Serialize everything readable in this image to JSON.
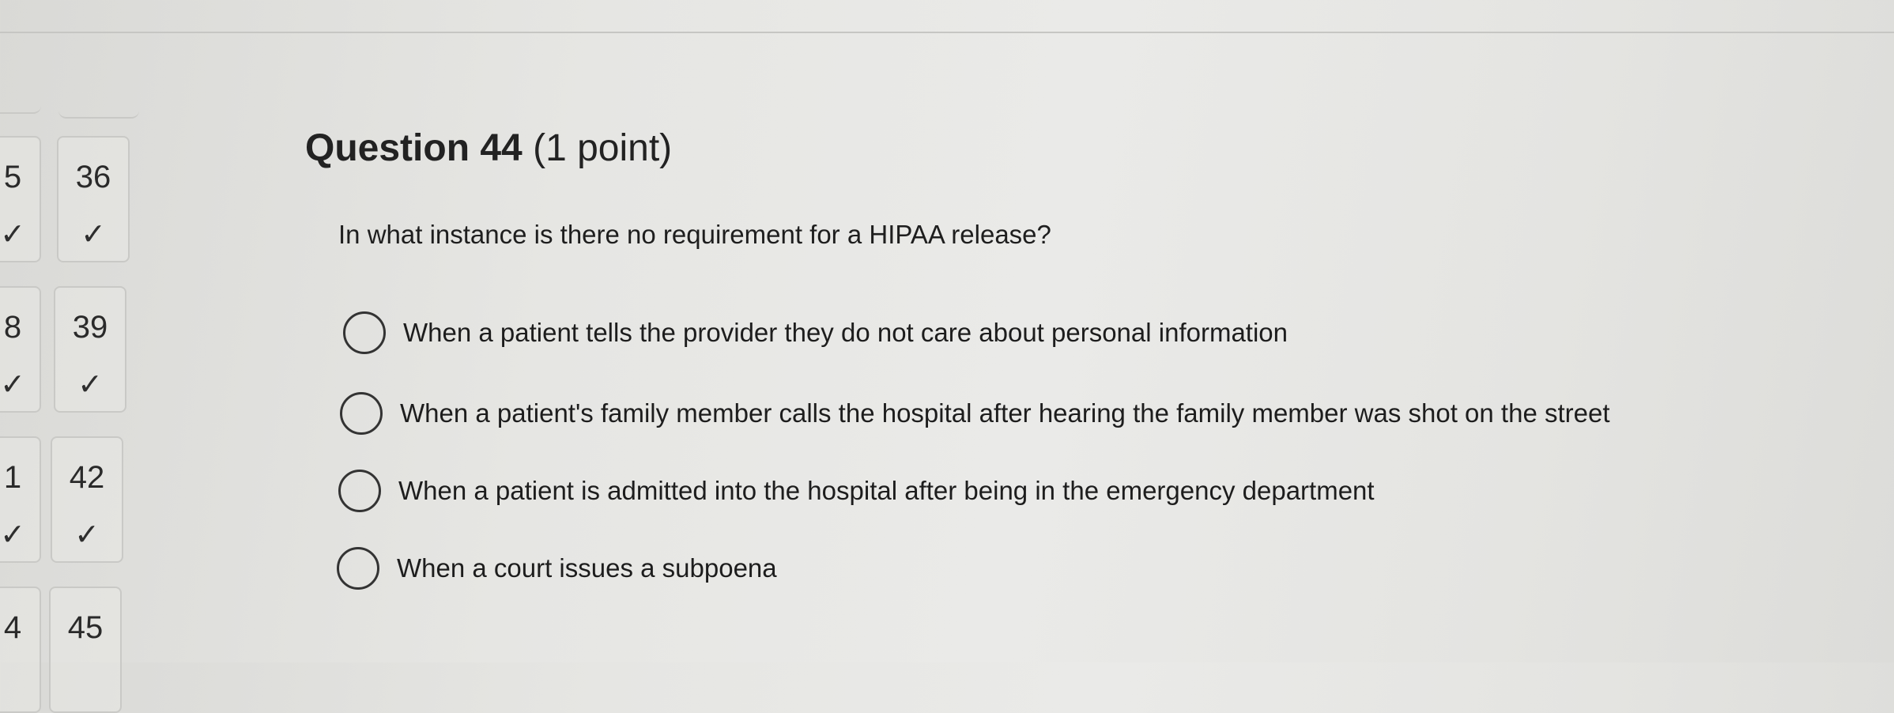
{
  "navigator": {
    "partial_column": [
      {
        "num": "5",
        "check": "✓"
      },
      {
        "num": "8",
        "check": "✓"
      },
      {
        "num": "1",
        "check": "✓"
      },
      {
        "num": "4",
        "check": ""
      }
    ],
    "column": [
      {
        "num": "36",
        "check": "✓"
      },
      {
        "num": "39",
        "check": "✓"
      },
      {
        "num": "42",
        "check": "✓"
      },
      {
        "num": "45",
        "check": ""
      }
    ]
  },
  "question": {
    "title": "Question 44",
    "points": "(1 point)",
    "text": "In what instance is there no requirement for a HIPAA release?",
    "options": [
      {
        "label": "When a patient tells the provider they do not care about personal information",
        "selected": false
      },
      {
        "label": "When a patient's family member calls the hospital after hearing the family member was shot on the street",
        "selected": false
      },
      {
        "label": "When a patient is admitted into the hospital after being in the emergency department",
        "selected": false
      },
      {
        "label": "When a court issues a subpoena",
        "selected": false
      }
    ]
  }
}
